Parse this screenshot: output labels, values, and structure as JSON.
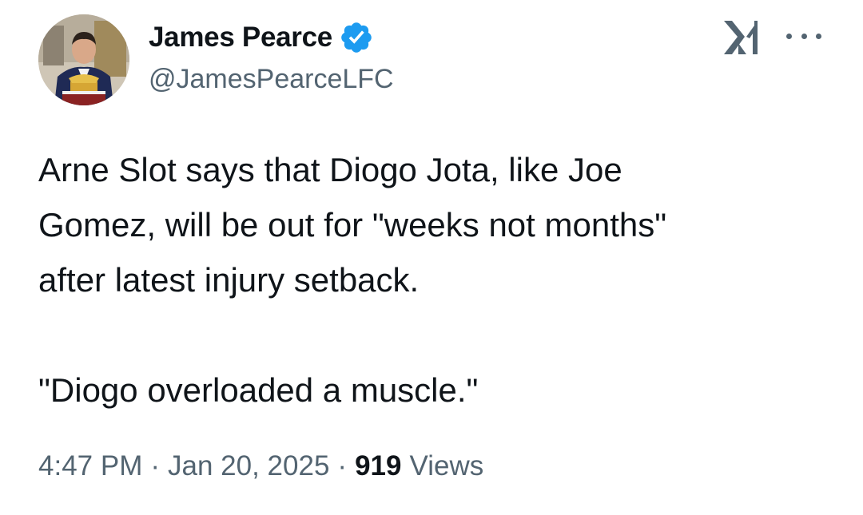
{
  "author": {
    "display_name": "James Pearce",
    "handle": "@JamesPearceLFC",
    "verified": true,
    "avatar_icon": "profile-photo"
  },
  "header": {
    "logo_icon": "x-logo-icon",
    "more_icon": "more-horizontal-icon"
  },
  "tweet": {
    "lines": [
      "Arne Slot says that Diogo Jota, like Joe",
      "Gomez, will be out for \"weeks not months\"",
      "after latest injury setback."
    ],
    "quote": "\"Diogo overloaded a muscle.\""
  },
  "meta": {
    "time": "4:47 PM",
    "separator": "·",
    "date": "Jan 20, 2025",
    "views_count": "919",
    "views_label": "Views"
  },
  "colors": {
    "text": "#0f1419",
    "secondary": "#536471",
    "verified_blue": "#1d9bf0"
  }
}
